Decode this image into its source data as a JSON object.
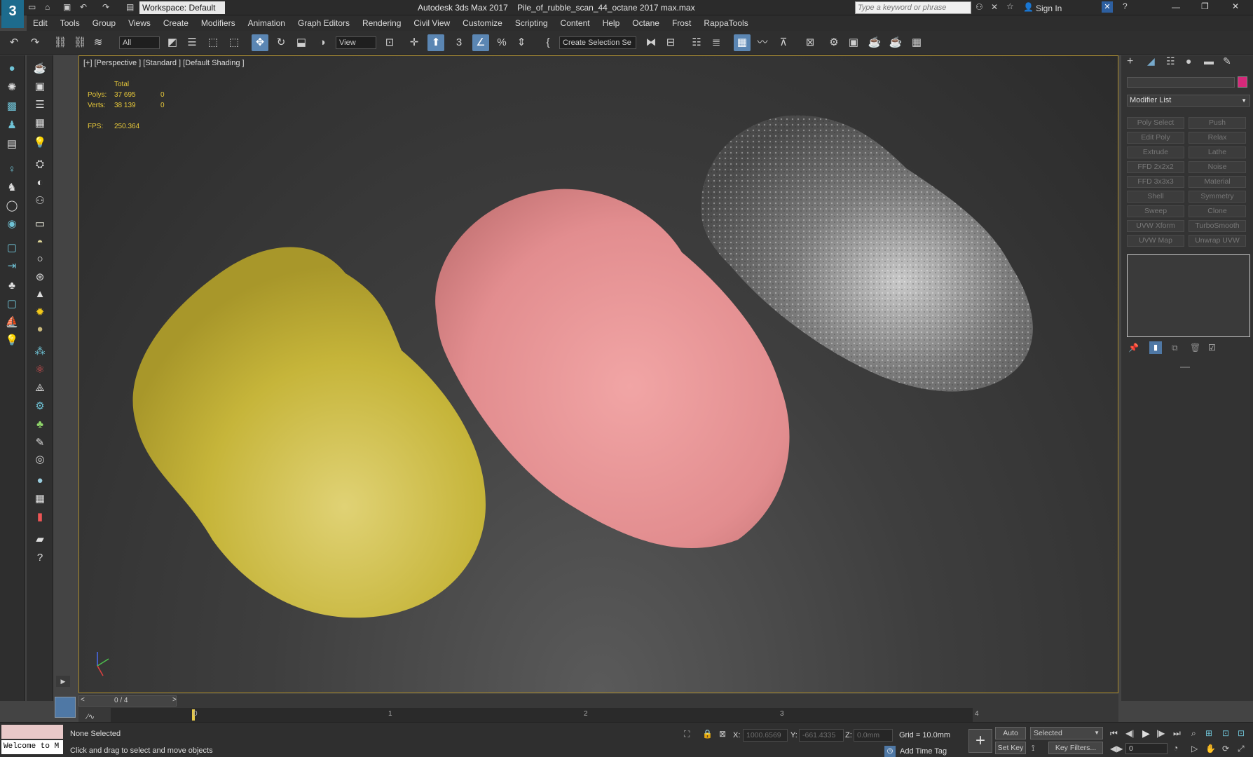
{
  "window": {
    "title": "Autodesk 3ds Max 2017",
    "filename": "Pile_of_rubble_scan_44_octane 2017 max.max",
    "workspace": "Workspace: Default",
    "search_placeholder": "Type a keyword or phrase",
    "sign_in": "Sign In"
  },
  "menu": [
    "Edit",
    "Tools",
    "Group",
    "Views",
    "Create",
    "Modifiers",
    "Animation",
    "Graph Editors",
    "Rendering",
    "Civil View",
    "Customize",
    "Scripting",
    "Content",
    "Help",
    "Octane",
    "Frost",
    "RappaTools"
  ],
  "toolbar": {
    "filter": "All",
    "ref_coord": "View",
    "selection_set": "Create Selection Se"
  },
  "viewport": {
    "label": "[+] [Perspective ] [Standard ] [Default Shading ]",
    "stats": {
      "total_label": "Total",
      "polys_label": "Polys:",
      "polys": "37 695",
      "polys_sel": "0",
      "verts_label": "Verts:",
      "verts": "38 139",
      "verts_sel": "0",
      "fps_label": "FPS:",
      "fps": "250.364"
    }
  },
  "command_panel": {
    "modifier_list": "Modifier List",
    "modifiers": [
      "Poly Select",
      "Push",
      "Edit Poly",
      "Relax",
      "Extrude",
      "Lathe",
      "FFD 2x2x2",
      "Noise",
      "FFD 3x3x3",
      "Material",
      "Shell",
      "Symmetry",
      "Sweep",
      "Clone",
      "UVW Xform",
      "TurboSmooth",
      "UVW Map",
      "Unwrap UVW"
    ],
    "colors": {
      "object_color": "#d6287a"
    }
  },
  "timeline": {
    "frame": "0 / 4",
    "ticks": [
      "0",
      "1",
      "2",
      "3",
      "4"
    ]
  },
  "status": {
    "maxscript": "Welcome to M",
    "selection": "None Selected",
    "prompt": "Click and drag to select and move objects",
    "x_label": "X:",
    "x": "1000.6569",
    "y_label": "Y:",
    "y": "-661.4335",
    "z_label": "Z:",
    "z": "0.0mm",
    "grid": "Grid = 10.0mm",
    "add_time_tag": "Add Time Tag",
    "auto_key": "Auto Key",
    "set_key": "Set Key",
    "selected": "Selected",
    "key_filters": "Key Filters...",
    "frame_field": "0"
  },
  "object_colors": {
    "yellow": "#c9b83a",
    "pink": "#e8989a",
    "gray": "#8a8a8a"
  }
}
